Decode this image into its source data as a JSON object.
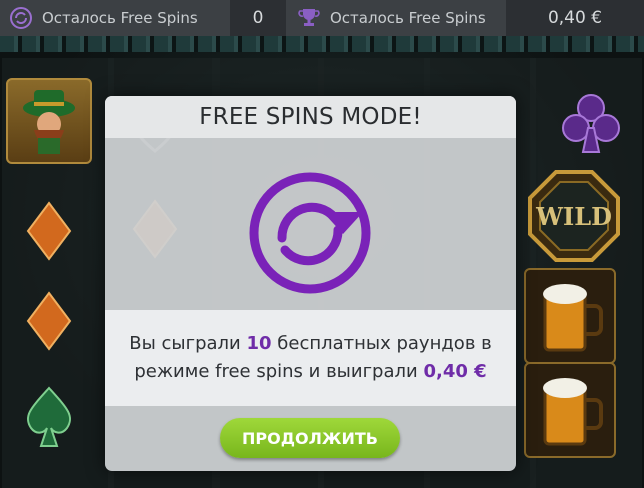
{
  "topbar": {
    "spins_label": "Осталось Free Spins",
    "spins_value": "0",
    "win_label": "Осталось Free Spins",
    "win_value": "0,40 €",
    "spins_icon": "refresh-icon",
    "win_icon": "trophy-icon"
  },
  "modal": {
    "title": "FREE SPINS MODE!",
    "icon": "free-spins-cycle-icon",
    "text_before": "Вы сыграли",
    "rounds": "10",
    "text_middle": "бесплатных раундов в режиме free spins и выиграли",
    "amount": "0,40 €",
    "button_label": "ПРОДОЛЖИТЬ"
  },
  "reels": {
    "wild_label": "WILD",
    "symbols_left": [
      "leprechaun",
      "diamond",
      "diamond",
      "spade"
    ],
    "symbols_right": [
      "club",
      "wild",
      "beer-mug",
      "beer-mug"
    ]
  },
  "colors": {
    "accent_purple": "#6f2ca8",
    "button_green": "#8cc82a"
  }
}
